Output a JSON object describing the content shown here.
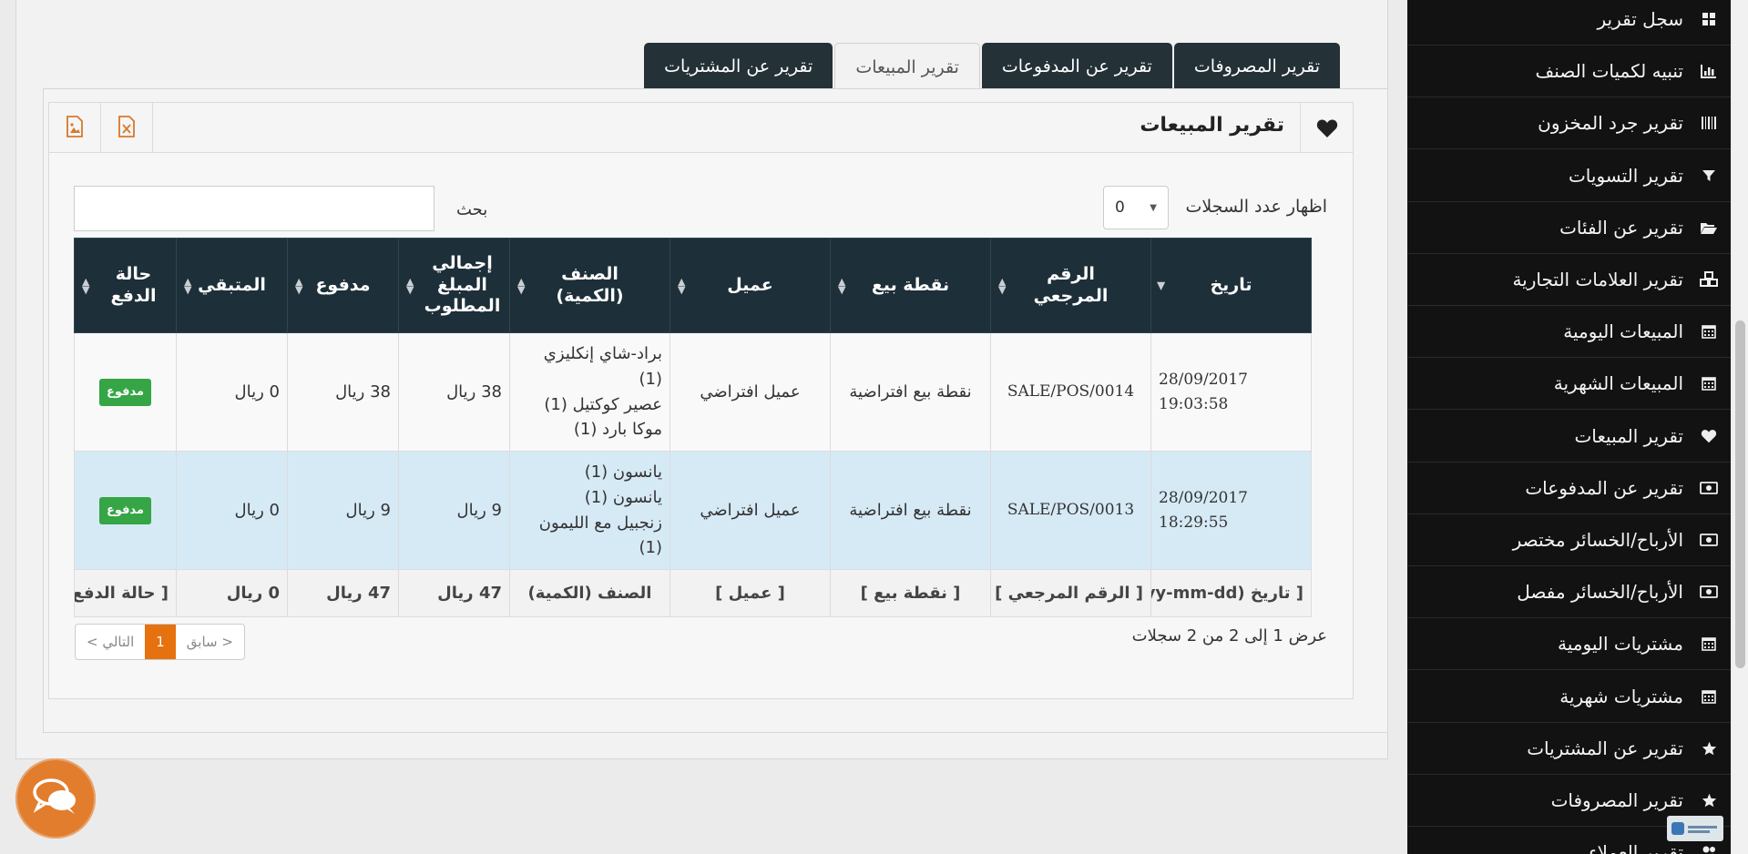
{
  "tabs": [
    {
      "label": "تقرير عن المشتريات",
      "active": false
    },
    {
      "label": "تقرير المبيعات",
      "active": true
    },
    {
      "label": "تقرير عن المدفوعات",
      "active": false
    },
    {
      "label": "تقرير المصروفات",
      "active": false
    }
  ],
  "card": {
    "title": "تقرير المبيعات",
    "title_icon": "heart-icon",
    "buttons": [
      "image-export-icon",
      "excel-export-icon"
    ]
  },
  "controls": {
    "show_label": "اظهار عدد السجلات",
    "show_value": "0",
    "search_label": "بحث",
    "search_value": ""
  },
  "table": {
    "headers": [
      "تاريخ",
      "الرقم المرجعي",
      "نقطة بيع",
      "عميل",
      "الصنف (الكمية)",
      "إجمالي المبلغ المطلوب",
      "مدفوع",
      "المتبقي",
      "حالة الدفع"
    ],
    "rows": [
      {
        "date": "28/09/2017",
        "time": "19:03:58",
        "ref": "SALE/POS/0014",
        "pos": "نقطة بيع افتراضية",
        "customer": "عميل افتراضي",
        "items": [
          "براد-شاي إنكليزي",
          "(1)",
          "عصير كوكتيل (1)",
          "موكا بارد (1)"
        ],
        "total": "38 ريال",
        "paid": "38 ريال",
        "balance": "0 ريال",
        "status": "مدفوع"
      },
      {
        "date": "28/09/2017",
        "time": "18:29:55",
        "ref": "SALE/POS/0013",
        "pos": "نقطة بيع افتراضية",
        "customer": "عميل افتراضي",
        "items": [
          "يانسون (1)",
          "يانسون (1)",
          "زنجبيل مع الليمون",
          "(1)"
        ],
        "total": "9 ريال",
        "paid": "9 ريال",
        "balance": "0 ريال",
        "status": "مدفوع"
      }
    ],
    "footer": {
      "date": "[ تاريخ  (yyyy-mm-dd)",
      "ref": "[ الرقم المرجعي ]",
      "pos": "[ نقطة بيع ]",
      "customer": "[ عميل ]",
      "items": "الصنف (الكمية)",
      "total": "47 ريال",
      "paid": "47 ريال",
      "balance": "0 ريال",
      "status": "[ حالة الدفع ]"
    }
  },
  "pagination": {
    "info": "عرض 1 إلى 2 من 2 سجلات",
    "prev": "< سابق",
    "current": "1",
    "next": "التالي >"
  },
  "sidebar": {
    "items": [
      {
        "label": "سجل تقرير",
        "icon": "grid-icon"
      },
      {
        "label": "تنبيه لكميات الصنف",
        "icon": "bar-chart-icon"
      },
      {
        "label": "تقرير جرد المخزون",
        "icon": "barcode-icon"
      },
      {
        "label": "تقرير التسويات",
        "icon": "filter-icon"
      },
      {
        "label": "تقرير عن الفئات",
        "icon": "folder-open-icon"
      },
      {
        "label": "تقرير العلامات التجارية",
        "icon": "cubes-icon"
      },
      {
        "label": "المبيعات اليومية",
        "icon": "calendar-icon"
      },
      {
        "label": "المبيعات الشهرية",
        "icon": "calendar-icon"
      },
      {
        "label": "تقرير المبيعات",
        "icon": "heart-icon"
      },
      {
        "label": "تقرير عن المدفوعات",
        "icon": "money-icon"
      },
      {
        "label": "الأرباح/الخسائر مختصر",
        "icon": "money-icon"
      },
      {
        "label": "الأرباح/الخسائر مفصل",
        "icon": "money-icon"
      },
      {
        "label": "مشتريات اليومية",
        "icon": "calendar-icon"
      },
      {
        "label": "مشتريات شهرية",
        "icon": "calendar-icon"
      },
      {
        "label": "تقرير عن المشتريات",
        "icon": "star-icon"
      },
      {
        "label": "تقرير المصروفات",
        "icon": "star-icon"
      },
      {
        "label": "تقرير العملاء",
        "icon": "users-icon"
      }
    ]
  },
  "colors": {
    "header_bg": "#1d2f39",
    "badge_paid": "#35a545",
    "pager_active": "#e6710f",
    "chat_bubble": "#e27d2d",
    "sidebar_bg": "#121212"
  }
}
